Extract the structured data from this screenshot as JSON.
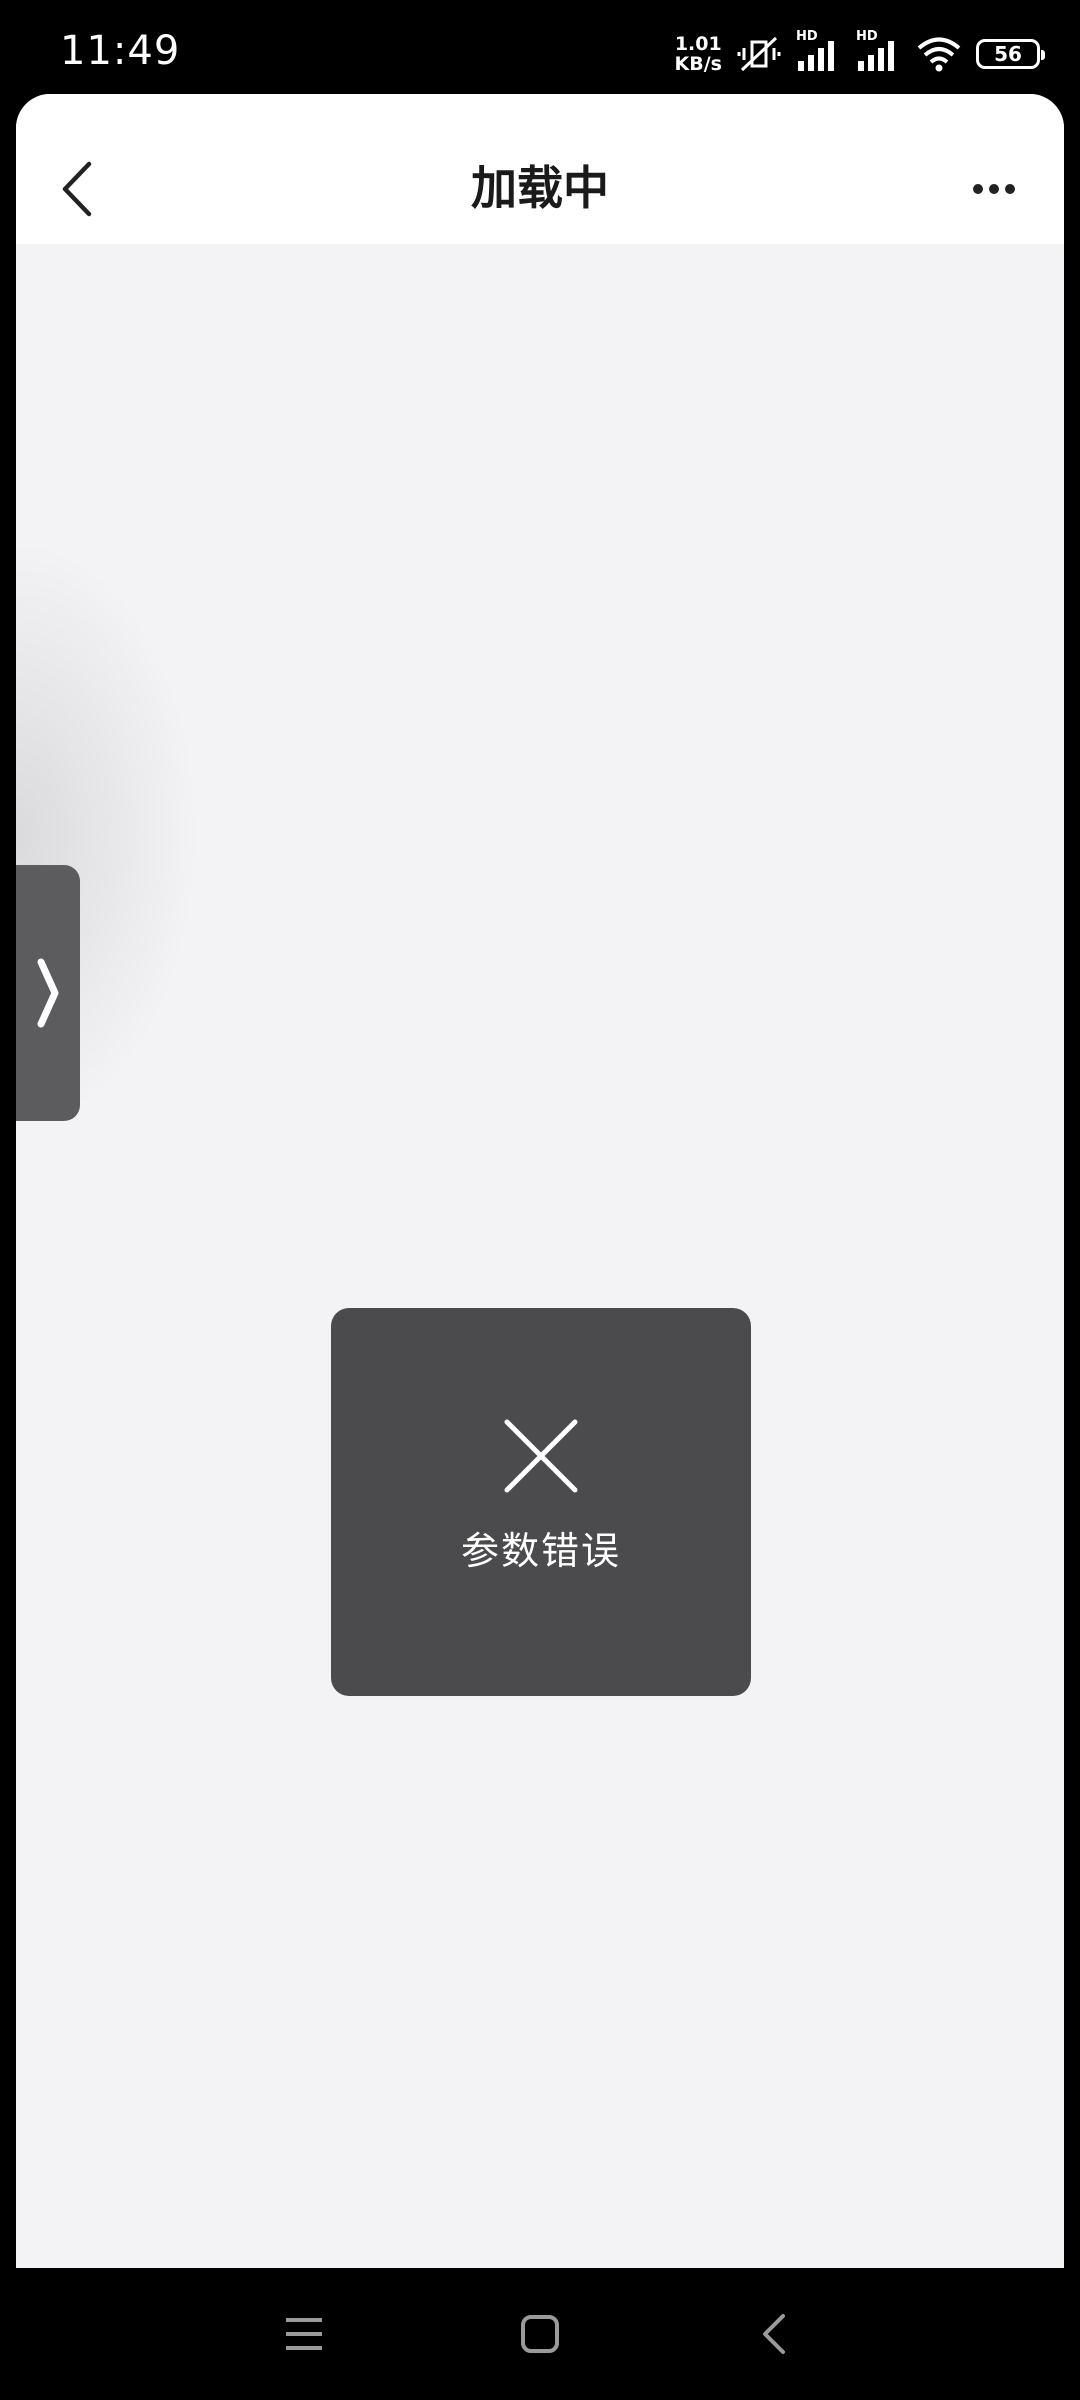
{
  "status_bar": {
    "time": "11:49",
    "net_speed_value": "1.01",
    "net_speed_unit": "KB/s",
    "signal1_label": "HD",
    "signal2_label": "HD",
    "battery": "56",
    "icons": [
      "mute-vibrate-icon",
      "signal-icon",
      "signal-icon",
      "wifi-icon",
      "battery-icon"
    ]
  },
  "nav": {
    "title": "加载中",
    "back_icon": "chevron-left-icon",
    "more_icon": "more-dots-icon"
  },
  "side_tab": {
    "icon": "chevron-right-icon"
  },
  "toast": {
    "icon": "close-x-icon",
    "message": "参数错误"
  },
  "system_nav": {
    "buttons": [
      "menu-icon",
      "home-icon",
      "back-icon"
    ]
  },
  "colors": {
    "background": "#f3f3f5",
    "toast_bg": "#4b4b4d",
    "side_tab_bg": "#5c5c5e",
    "nav_bg": "#ffffff"
  }
}
